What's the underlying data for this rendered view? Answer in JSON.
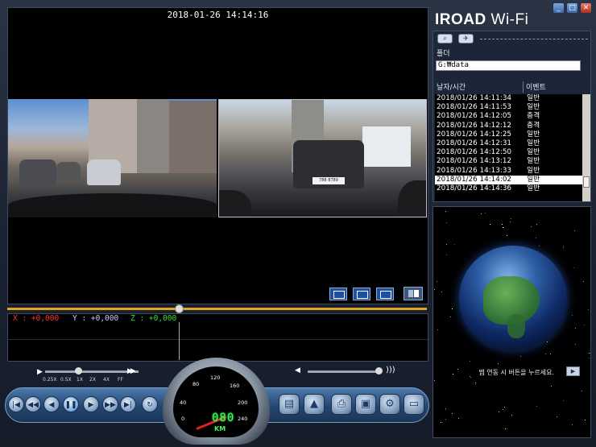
{
  "player": {
    "timestamp": "2018-01-26 14:14:16",
    "gsensor": {
      "x": "X : +0,000",
      "y": "Y : +0,000",
      "z": "Z : +0,000"
    },
    "speed_labels": [
      "0.25X",
      "0.5X",
      "1X",
      "2X",
      "4X",
      "FF"
    ],
    "gauge": {
      "ticks": [
        "0",
        "40",
        "80",
        "120",
        "160",
        "200",
        "240"
      ],
      "digital": "080",
      "unit": "KM"
    },
    "front_plate": "",
    "rear_plate": "788 8789"
  },
  "panel": {
    "logo_main": "IROAD",
    "logo_sub": " Wi-Fi",
    "folder_label": "폴더",
    "folder_path": "G:₩data",
    "columns": {
      "datetime": "날자/시간",
      "event": "이벤트"
    },
    "files": [
      {
        "datetime": "2018/01/26 14:11:34",
        "event": "일반"
      },
      {
        "datetime": "2018/01/26 14:11:53",
        "event": "일반"
      },
      {
        "datetime": "2018/01/26 14:12:05",
        "event": "충격"
      },
      {
        "datetime": "2018/01/26 14:12:12",
        "event": "충격"
      },
      {
        "datetime": "2018/01/26 14:12:25",
        "event": "일반"
      },
      {
        "datetime": "2018/01/26 14:12:31",
        "event": "일반"
      },
      {
        "datetime": "2018/01/26 14:12:50",
        "event": "일반"
      },
      {
        "datetime": "2018/01/26 14:13:12",
        "event": "일반"
      },
      {
        "datetime": "2018/01/26 14:13:33",
        "event": "일반"
      },
      {
        "datetime": "2018/01/26 14:14:02",
        "event": "일반"
      },
      {
        "datetime": "2018/01/26 14:14:36",
        "event": "일반"
      }
    ],
    "selected_index": 9,
    "map_message": "맵 연동 시 버튼을 누르세요."
  },
  "icons": {
    "window": [
      "minimize-icon",
      "maximize-icon",
      "close-icon"
    ],
    "toolbar": [
      "search-icon",
      "satellite-icon"
    ],
    "playback": [
      "skip-start-icon",
      "prev-icon",
      "step-back-icon",
      "pause-icon",
      "play-icon",
      "step-forward-icon",
      "skip-end-icon",
      "repeat-icon"
    ],
    "functions": [
      "film-icon",
      "upload-icon",
      "print-icon",
      "save-icon",
      "settings-icon",
      "folder-icon"
    ]
  },
  "colors": {
    "accent": "#e3a521",
    "x_axis": "#ff3030",
    "y_axis": "#c8c8ff",
    "z_axis": "#30e030",
    "gauge_digits": "#3dff5d"
  }
}
